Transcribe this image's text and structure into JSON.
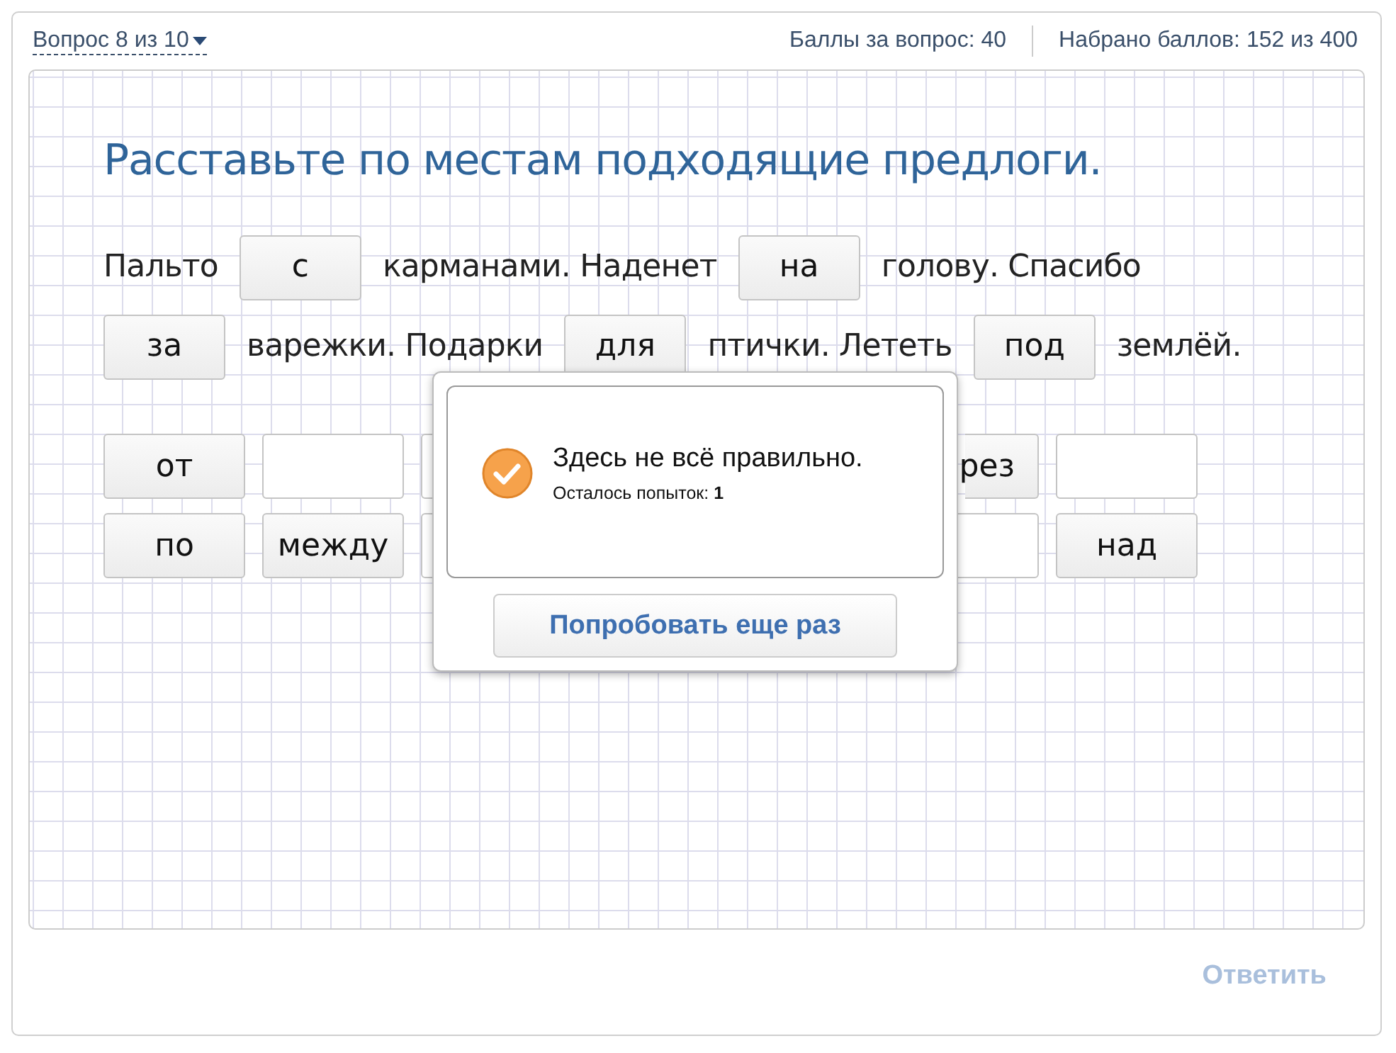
{
  "header": {
    "question_picker": "Вопрос 8 из 10",
    "points_for_question": "Баллы за вопрос: 40",
    "total_points": "Набрано баллов: 152 из 400"
  },
  "task": {
    "title": "Расставьте по местам подходящие предлоги.",
    "sentence_lines": [
      [
        {
          "kind": "text",
          "text": "Пальто"
        },
        {
          "kind": "slot",
          "text": "с"
        },
        {
          "kind": "text",
          "text": "карманами. Наденет"
        },
        {
          "kind": "slot",
          "text": "на"
        },
        {
          "kind": "text",
          "text": "голову. Спасибо"
        }
      ],
      [
        {
          "kind": "slot",
          "text": "за"
        },
        {
          "kind": "text",
          "text": "варежки. Подарки"
        },
        {
          "kind": "slot",
          "text": "для"
        },
        {
          "kind": "text",
          "text": "птички. Лететь"
        },
        {
          "kind": "slot",
          "text": "под"
        },
        {
          "kind": "text",
          "text": "землёй."
        }
      ]
    ],
    "word_bank": [
      [
        {
          "kind": "word",
          "text": "от"
        },
        {
          "kind": "blank"
        },
        {
          "kind": "blank"
        },
        {
          "kind": "gap"
        },
        {
          "kind": "gap"
        },
        {
          "kind": "clipped",
          "text": "рез"
        },
        {
          "kind": "blank"
        }
      ],
      [
        {
          "kind": "word",
          "text": "по"
        },
        {
          "kind": "word",
          "text": "между"
        },
        {
          "kind": "blank"
        },
        {
          "kind": "gap"
        },
        {
          "kind": "gap"
        },
        {
          "kind": "blank"
        },
        {
          "kind": "word",
          "text": "над"
        }
      ]
    ]
  },
  "dialog": {
    "message": "Здесь не всё правильно.",
    "attempts_label": "Осталось попыток: ",
    "attempts": "1",
    "button": "Попробовать еще раз"
  },
  "answer_button": {
    "label": "Ответить",
    "disabled": true
  }
}
